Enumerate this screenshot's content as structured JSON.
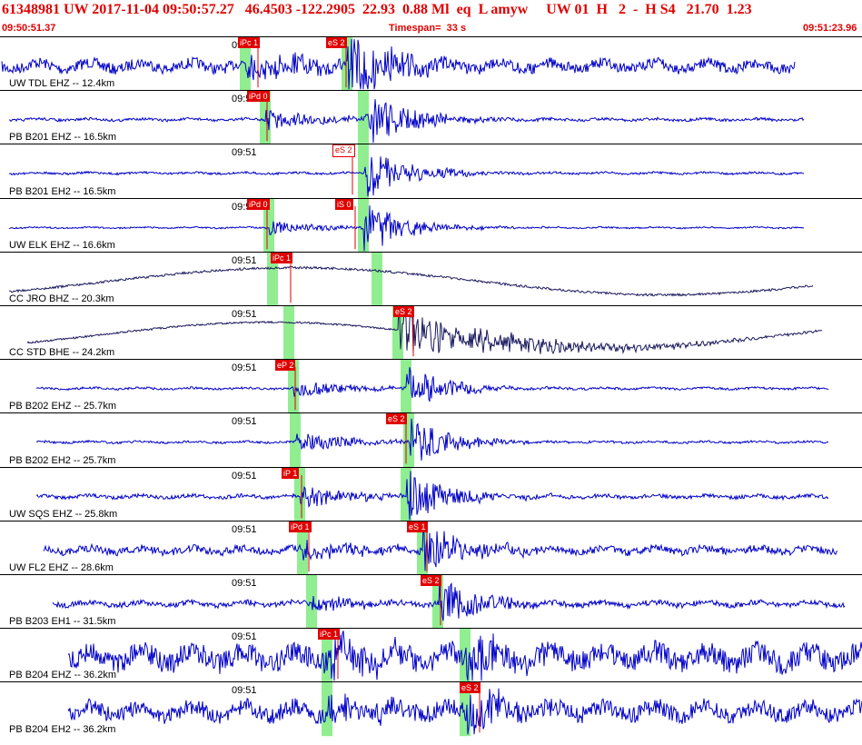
{
  "header": {
    "title": "61348981 UW 2017-11-04 09:50:57.27   46.4503 -122.2905  22.93  0.88 Ml  eq  L amyw     UW 01  H   2  -  H S4   21.70  1.23",
    "start_time": "09:50:51.37",
    "timespan": "Timespan=  33 s",
    "end_time": "09:51:23.96"
  },
  "colors": {
    "header_text": "#e00000",
    "trace": "#0000c8",
    "broadband_trace": "#1a1a5e",
    "pick_flag": "#e00000",
    "pick_window": "#90ee90"
  },
  "channels": [
    {
      "label": "UW TDL EHZ -- 12.4km",
      "time_tick": "09:51",
      "picks": [
        "iPc 1",
        "eS 2"
      ]
    },
    {
      "label": "PB B201 EHZ -- 16.5km",
      "time_tick": "09:51",
      "picks": [
        "iPd 0"
      ]
    },
    {
      "label": "PB B201 EH2 -- 16.5km",
      "time_tick": "09:51",
      "picks": [
        "eS 2"
      ]
    },
    {
      "label": "UW ELK EHZ -- 16.6km",
      "time_tick": "09:51",
      "picks": [
        "iPd 0",
        "iS 0"
      ]
    },
    {
      "label": "CC JRO BHZ -- 20.3km",
      "time_tick": "09:51",
      "picks": [
        "iPc 1"
      ]
    },
    {
      "label": "CC STD BHE -- 24.2km",
      "time_tick": "09:51",
      "picks": [
        "eS 2"
      ]
    },
    {
      "label": "PB B202 EHZ -- 25.7km",
      "time_tick": "09:51",
      "picks": [
        "eP 2"
      ]
    },
    {
      "label": "PB B202 EH2 -- 25.7km",
      "time_tick": "09:51",
      "picks": [
        "eS 2"
      ]
    },
    {
      "label": "UW SQS EHZ -- 25.8km",
      "time_tick": "09:51",
      "picks": [
        "iP 1"
      ]
    },
    {
      "label": "UW FL2 EHZ -- 28.6km",
      "time_tick": "09:51",
      "picks": [
        "iPd 1",
        "eS 1"
      ]
    },
    {
      "label": "PB B203 EH1 -- 31.5km",
      "time_tick": "09:51",
      "picks": [
        "eS 2"
      ]
    },
    {
      "label": "PB B204 EHZ -- 36.2km",
      "time_tick": "09:51",
      "picks": [
        "iPc 1"
      ]
    },
    {
      "label": "PB B204 EH2 -- 36.2km",
      "time_tick": "09:51",
      "picks": [
        "eS 2"
      ]
    }
  ]
}
